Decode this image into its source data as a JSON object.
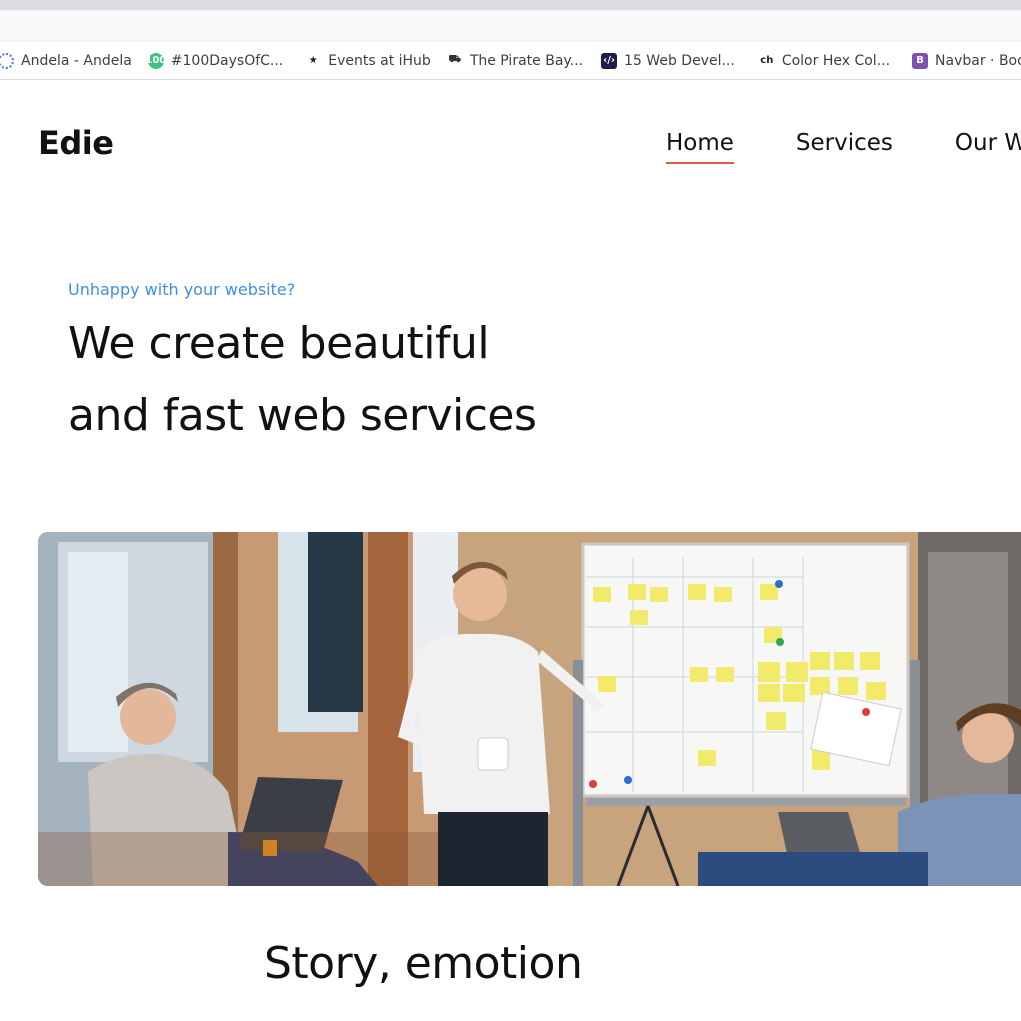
{
  "bookmarks": [
    {
      "label": "Andela - Andela",
      "icon": "andela-icon"
    },
    {
      "label": "#100DaysOfC...",
      "icon": "hundred-days-icon"
    },
    {
      "label": "Events at iHub",
      "icon": "star-events-icon"
    },
    {
      "label": "The Pirate Bay...",
      "icon": "pirate-ship-icon"
    },
    {
      "label": "15 Web Devel...",
      "icon": "web-dev-icon"
    },
    {
      "label": "Color Hex Col...",
      "icon": "ch-icon"
    },
    {
      "label": "Navbar · Boot...",
      "icon": "bootstrap-icon"
    }
  ],
  "bookmark_glyphs": {
    "hundred": "100",
    "events": "★",
    "pirate": "⛟",
    "webdev": "‹/›",
    "ch": "ch",
    "boot": "B"
  },
  "site": {
    "logo": "Edie",
    "nav": [
      "Home",
      "Services",
      "Our W"
    ]
  },
  "hero": {
    "eyebrow": "Unhappy with your website?",
    "headline_line1": "We create beautiful",
    "headline_line2": "and fast web services"
  },
  "section": {
    "subheading": "Story, emotion"
  },
  "colors": {
    "accent_underline": "#e05a47",
    "eyebrow_blue": "#3f8fdc"
  }
}
